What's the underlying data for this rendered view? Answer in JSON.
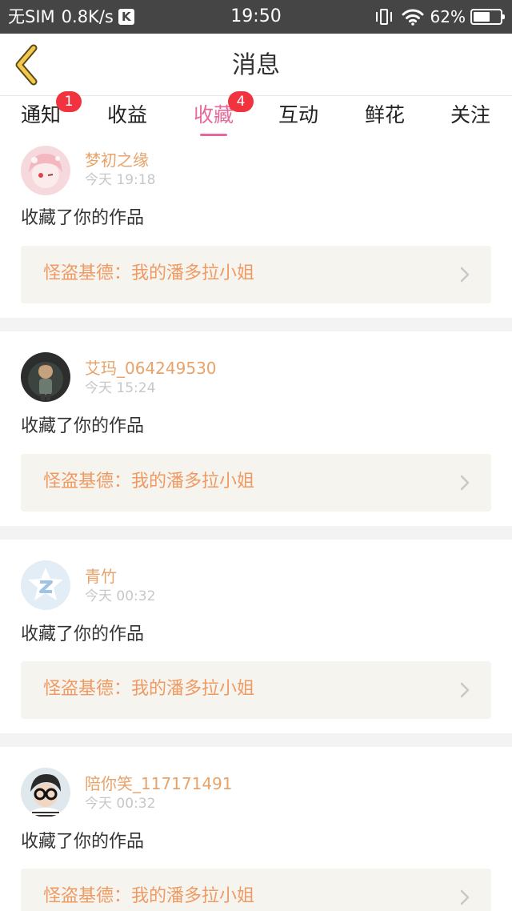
{
  "status_bar": {
    "carrier": "无SIM",
    "speed": "0.8K/s",
    "k_icon": "K",
    "time": "19:50",
    "battery": "62%",
    "battery_level": 0.62
  },
  "header": {
    "title": "消息"
  },
  "tabs": [
    {
      "label": "通知",
      "badge": "1"
    },
    {
      "label": "收益"
    },
    {
      "label": "收藏",
      "badge": "4",
      "active": true
    },
    {
      "label": "互动"
    },
    {
      "label": "鲜花"
    },
    {
      "label": "关注"
    }
  ],
  "messages": [
    {
      "name": "梦初之缘",
      "time": "今天 19:18",
      "action": "收藏了你的作品",
      "work": "怪盗基德：我的潘多拉小姐",
      "avatar": "pink-anime-avatar"
    },
    {
      "name": "艾玛_064249530",
      "time": "今天 15:24",
      "action": "收藏了你的作品",
      "work": "怪盗基德：我的潘多拉小姐",
      "avatar": "dark-character-avatar"
    },
    {
      "name": "青竹",
      "time": "今天 00:32",
      "action": "收藏了你的作品",
      "work": "怪盗基德：我的潘多拉小姐",
      "avatar": "default-z-avatar"
    },
    {
      "name": "陪你笑_117171491",
      "time": "今天 00:32",
      "action": "收藏了你的作品",
      "work": "怪盗基德：我的潘多拉小姐",
      "avatar": "boy-glasses-avatar"
    }
  ],
  "colors": {
    "status_bar_bg": "#454545",
    "accent_pink": "#e56a9b",
    "badge_red": "#f0333f",
    "name_orange": "#e8a36a",
    "work_orange": "#f09a63",
    "back_arrow": "#f2c94c"
  }
}
